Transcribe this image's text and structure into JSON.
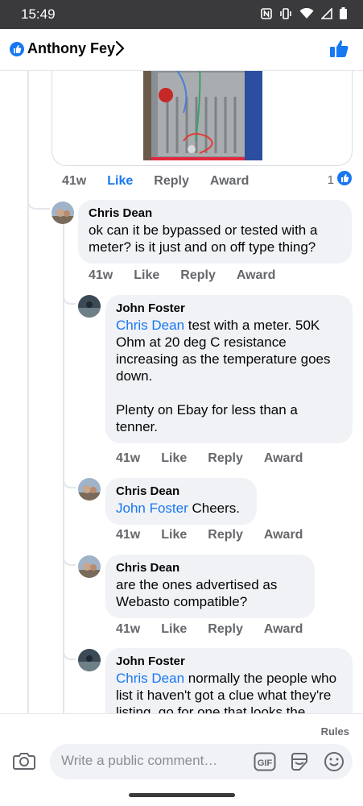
{
  "status_bar": {
    "time": "15:49",
    "icons": [
      "nfc-icon",
      "vibrate-icon",
      "wifi-icon",
      "signal-icon",
      "battery-icon"
    ]
  },
  "header": {
    "title": "Anthony Fey",
    "icons": [
      "like-badge-icon",
      "chevron-right-icon",
      "thumbs-up-icon"
    ]
  },
  "colors": {
    "accent": "#1877f2",
    "bubble": "#f0f2f5",
    "muted": "#65676b",
    "status_bar": "#3a3a3c"
  },
  "parent_comment": {
    "time": "41w",
    "like": "Like",
    "reply": "Reply",
    "award": "Award",
    "reaction_count": "1"
  },
  "comments": [
    {
      "author": "Chris Dean",
      "text": "ok can it be bypassed or tested with a meter? is it just and on off type thing?",
      "time": "41w",
      "like": "Like",
      "reply": "Reply",
      "award": "Award"
    },
    {
      "author": "John Foster",
      "mention": "Chris Dean",
      "text": " test with a meter. 50K Ohm at 20 deg C resistance increasing as the temperature goes down.",
      "text2": "Plenty on Ebay for less than a tenner.",
      "time": "41w",
      "like": "Like",
      "reply": "Reply",
      "award": "Award"
    },
    {
      "author": "Chris Dean",
      "mention": "John Foster",
      "text": " Cheers.",
      "time": "41w",
      "like": "Like",
      "reply": "Reply",
      "award": "Award"
    },
    {
      "author": "Chris Dean",
      "text": "are the ones advertised as Webasto compatible?",
      "time": "41w",
      "like": "Like",
      "reply": "Reply",
      "award": "Award"
    },
    {
      "author": "John Foster",
      "mention": "Chris Dean",
      "text": " normally the people who list it haven't got a clue what they're listing, go for one that looks the"
    }
  ],
  "composer": {
    "rules": "Rules",
    "placeholder": "Write a public comment…",
    "gif": "GIF",
    "icons": [
      "camera-icon",
      "gif-icon",
      "sticker-icon",
      "emoji-icon"
    ]
  }
}
